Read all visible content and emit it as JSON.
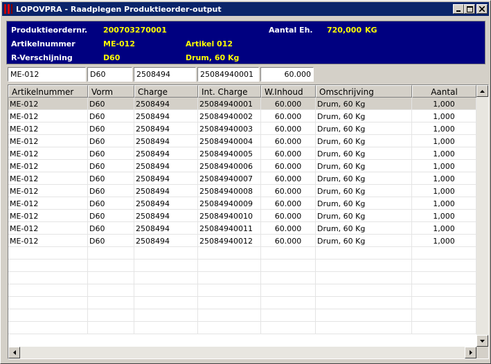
{
  "window": {
    "title": "LOPOVPRA - Raadplegen Produktieorder-output",
    "minimize_icon": "minimize-icon",
    "maximize_icon": "maximize-icon",
    "close_icon": "close-icon"
  },
  "header": {
    "order_label": "Produktieordernr.",
    "order_value": "200703270001",
    "qty_label": "Aantal Eh.",
    "qty_value": "720,000",
    "qty_unit": "KG",
    "article_label": "Artikelnummer",
    "article_value": "ME-012",
    "article_desc": "Artikel 012",
    "rvers_label": "R-Verschijning",
    "rvers_value": "D60",
    "rvers_desc": "Drum, 60 Kg"
  },
  "filters": {
    "artikel": "ME-012",
    "vorm": "D60",
    "charge": "2508494",
    "int_charge": "25084940001",
    "w_inhoud": "60.000"
  },
  "grid": {
    "columns": [
      "Artikelnummer",
      "Vorm",
      "Charge",
      "Int. Charge",
      "W.Inhoud",
      "Omschrijving",
      "Aantal"
    ],
    "rows": [
      [
        "ME-012",
        "D60",
        "2508494",
        "25084940001",
        "60.000",
        "Drum, 60 Kg",
        "1,000"
      ],
      [
        "ME-012",
        "D60",
        "2508494",
        "25084940002",
        "60.000",
        "Drum, 60 Kg",
        "1,000"
      ],
      [
        "ME-012",
        "D60",
        "2508494",
        "25084940003",
        "60.000",
        "Drum, 60 Kg",
        "1,000"
      ],
      [
        "ME-012",
        "D60",
        "2508494",
        "25084940004",
        "60.000",
        "Drum, 60 Kg",
        "1,000"
      ],
      [
        "ME-012",
        "D60",
        "2508494",
        "25084940005",
        "60.000",
        "Drum, 60 Kg",
        "1,000"
      ],
      [
        "ME-012",
        "D60",
        "2508494",
        "25084940006",
        "60.000",
        "Drum, 60 Kg",
        "1,000"
      ],
      [
        "ME-012",
        "D60",
        "2508494",
        "25084940007",
        "60.000",
        "Drum, 60 Kg",
        "1,000"
      ],
      [
        "ME-012",
        "D60",
        "2508494",
        "25084940008",
        "60.000",
        "Drum, 60 Kg",
        "1,000"
      ],
      [
        "ME-012",
        "D60",
        "2508494",
        "25084940009",
        "60.000",
        "Drum, 60 Kg",
        "1,000"
      ],
      [
        "ME-012",
        "D60",
        "2508494",
        "25084940010",
        "60.000",
        "Drum, 60 Kg",
        "1,000"
      ],
      [
        "ME-012",
        "D60",
        "2508494",
        "25084940011",
        "60.000",
        "Drum, 60 Kg",
        "1,000"
      ],
      [
        "ME-012",
        "D60",
        "2508494",
        "25084940012",
        "60.000",
        "Drum, 60 Kg",
        "1,000"
      ]
    ],
    "empty_rows": 7
  },
  "colors": {
    "header_bg": "#000080",
    "header_value": "#ffff00",
    "titlebar": "#0a246a"
  }
}
